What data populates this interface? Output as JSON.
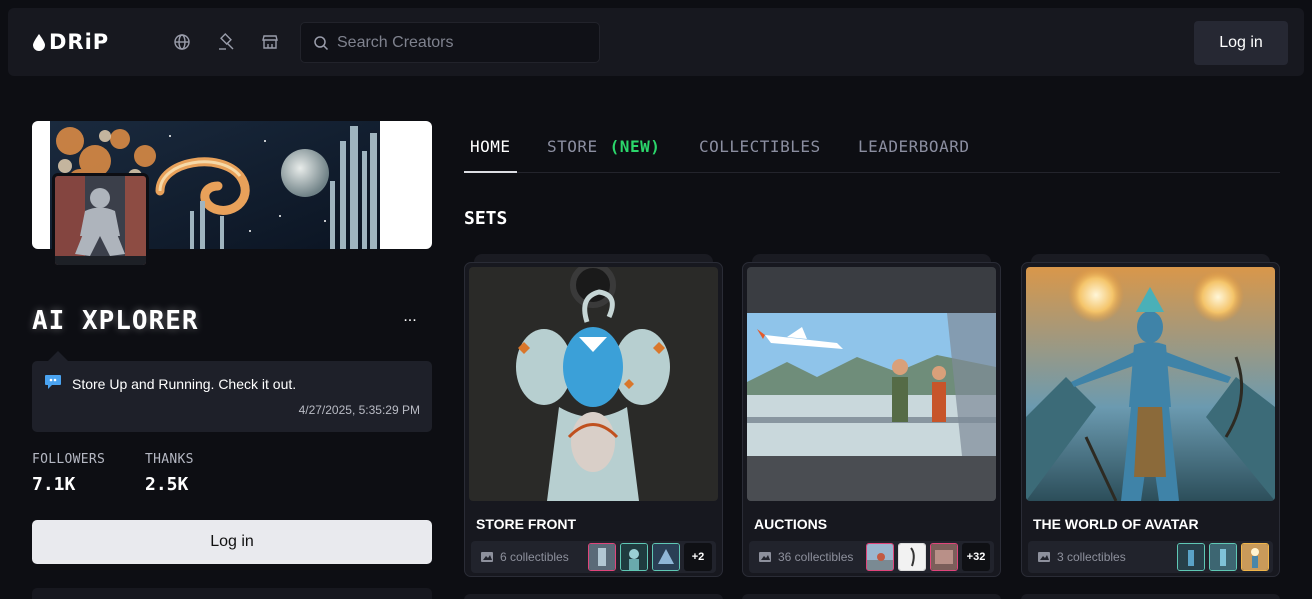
{
  "header": {
    "logo_text": "DRiP",
    "nav_icons": [
      "globe-icon",
      "gavel-icon",
      "store-icon"
    ],
    "search_placeholder": "Search Creators",
    "login_label": "Log in"
  },
  "profile": {
    "name": "AI XPLORER",
    "more_label": "...",
    "status": {
      "text": "Store Up and Running. Check it out.",
      "timestamp": "4/27/2025, 5:35:29 PM"
    },
    "stats": [
      {
        "label": "FOLLOWERS",
        "value": "7.1K"
      },
      {
        "label": "THANKS",
        "value": "2.5K"
      }
    ],
    "login_label": "Log in"
  },
  "tabs": [
    {
      "label": "HOME",
      "badge": ""
    },
    {
      "label": "STORE",
      "badge": "(NEW)"
    },
    {
      "label": "COLLECTIBLES",
      "badge": ""
    },
    {
      "label": "LEADERBOARD",
      "badge": ""
    }
  ],
  "sets_title": "SETS",
  "sets": [
    {
      "title": "STORE FRONT",
      "count": "6 collectibles",
      "more": "+2"
    },
    {
      "title": "AUCTIONS",
      "count": "36 collectibles",
      "more": "+32"
    },
    {
      "title": "THE WORLD OF AVATAR",
      "count": "3 collectibles",
      "more": ""
    }
  ],
  "colors": {
    "accent_new": "#2bd66b",
    "background": "#0d0e13",
    "thumb_border_pink": "#e0457b",
    "thumb_border_teal": "#5fc8b5"
  }
}
